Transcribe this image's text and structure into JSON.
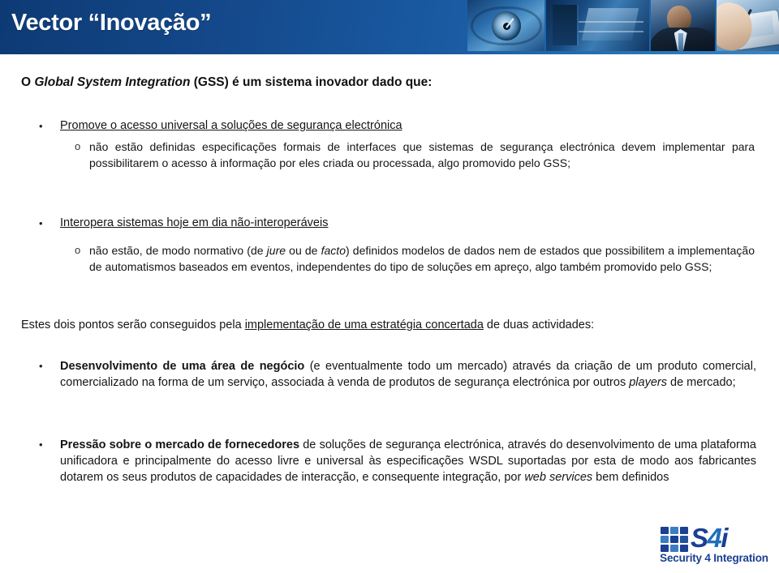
{
  "header": {
    "title": "Vector “Inovação”",
    "accent_dark": "#0d3a74",
    "accent_light": "#3a86c4",
    "panels": [
      {
        "name": "eye-clock-image"
      },
      {
        "name": "server-room-image"
      },
      {
        "name": "businessman-image"
      },
      {
        "name": "pda-stylus-image"
      }
    ]
  },
  "content": {
    "heading_pre": "O ",
    "heading_italic": "Global System Integration",
    "heading_post": " (GSS) é um sistema inovador dado que:",
    "bullet_level1_marker": "•",
    "bullet_level2_marker": "o",
    "b1_text": "Promove o acesso universal a soluções de segurança electrónica",
    "b1_sub": "não estão definidas especificações formais de interfaces que sistemas de segurança electrónica devem implementar para possibilitarem o acesso à informação por eles criada ou processada, algo promovido pelo GSS;",
    "b2_text": "Interopera sistemas hoje em dia não-interoperáveis",
    "b2_sub_pre": "não estão, de modo normativo (de ",
    "b2_sub_italic": "jure",
    "b2_sub_mid": " ou de ",
    "b2_sub_italic2": "facto",
    "b2_sub_post": ") definidos modelos de dados nem de estados que possibilitem a implementação de automatismos baseados em eventos, independentes do tipo de soluções em apreço, algo também promovido pelo GSS;",
    "transition_pre": "Estes dois pontos serão conseguidos pela ",
    "transition_underlined": "implementação de uma estratégia concertada",
    "transition_post": " de duas actividades:",
    "p1_bold": "Desenvolvimento de uma área de negócio",
    "p1_mid": " (e eventualmente todo um mercado) através da criação de um produto comercial, comercializado na forma de um serviço, associada à venda de produtos de segurança electrónica por outros ",
    "p1_italic": "players",
    "p1_post": " de mercado;",
    "p2_bold": "Pressão sobre o mercado de fornecedores",
    "p2_mid": " de soluções de segurança electrónica, através do desenvolvimento de uma plataforma unificadora e principalmente do acesso livre e universal às especificações WSDL suportadas por esta de modo aos fabricantes dotarem os seus produtos de capacidades de interacção, e consequente integração, por ",
    "p2_italic": "web services",
    "p2_post": " bem definidos"
  },
  "logo": {
    "mark_s": "S",
    "mark_4": "4",
    "mark_i": "i",
    "tagline": "Security 4 Integration",
    "primary_color": "#1b3f92",
    "secondary_color": "#1f6fb8"
  }
}
